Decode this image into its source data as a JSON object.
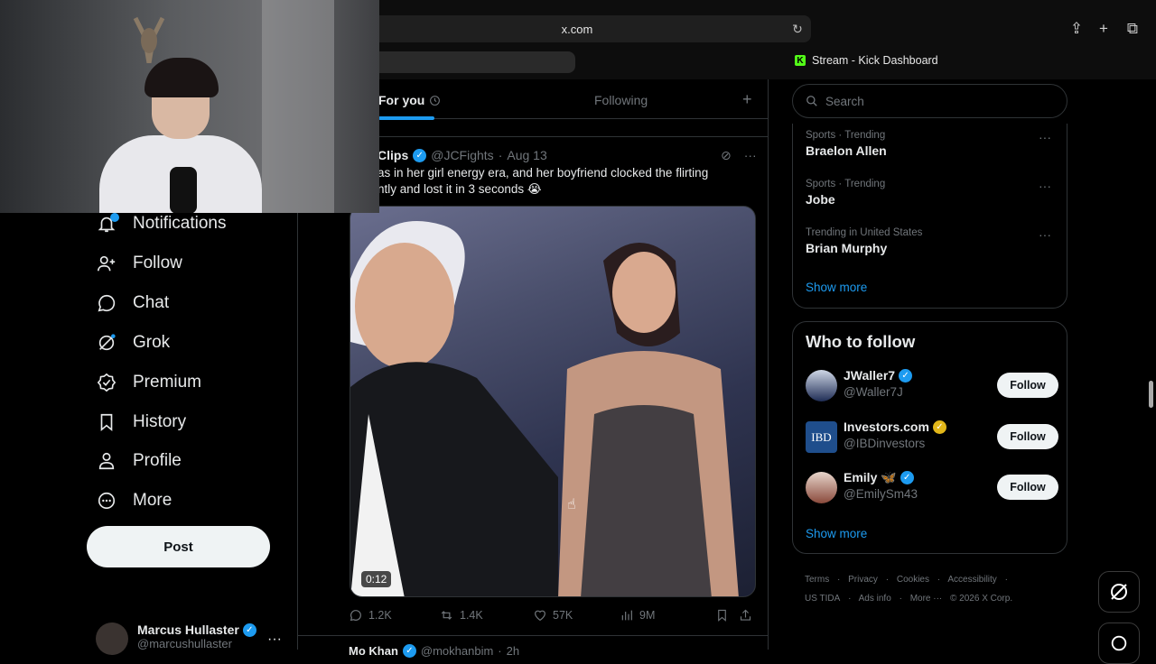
{
  "browser": {
    "url": "x.com",
    "kick_tab_label": "Stream - Kick Dashboard",
    "kick_logo": "K"
  },
  "sidebar": {
    "items": [
      {
        "label": "Notifications",
        "icon": "bell-icon"
      },
      {
        "label": "Follow",
        "icon": "add-person-icon"
      },
      {
        "label": "Chat",
        "icon": "chat-bubble-icon"
      },
      {
        "label": "Grok",
        "icon": "grok-icon"
      },
      {
        "label": "Premium",
        "icon": "verified-badge-icon"
      },
      {
        "label": "History",
        "icon": "bookmark-icon"
      },
      {
        "label": "Profile",
        "icon": "person-icon"
      },
      {
        "label": "More",
        "icon": "more-circle-icon"
      }
    ],
    "post_label": "Post",
    "account": {
      "name": "Marcus Hullaster",
      "handle": "@marcushullaster"
    }
  },
  "feed": {
    "tabs": {
      "for_you": "For you",
      "following": "Following"
    },
    "tweet": {
      "name": "Clips",
      "handle": "@JCFights",
      "date": "Aug 13",
      "text": "as in her girl energy era, and her boyfriend clocked the flirting ntly and lost it in 3 seconds 😭",
      "duration": "0:12",
      "replies": "1.2K",
      "reposts": "1.4K",
      "likes": "57K",
      "views": "9M"
    },
    "next_tweet": {
      "name": "Mo Khan",
      "handle": "@mokhanbim",
      "time": "2h"
    }
  },
  "right": {
    "search_placeholder": "Search",
    "trends": [
      {
        "meta": "Sports · Trending",
        "title": "Braelon Allen"
      },
      {
        "meta": "Sports · Trending",
        "title": "Jobe"
      },
      {
        "meta": "Trending in United States",
        "title": "Brian Murphy"
      }
    ],
    "show_more": "Show more",
    "who_to_follow": {
      "title": "Who to follow",
      "accounts": [
        {
          "name": "JWaller7",
          "handle": "@Waller7J",
          "badge": "blue"
        },
        {
          "name": "Investors.com",
          "handle": "@IBDinvestors",
          "badge": "gold",
          "avatar_text": "IBD"
        },
        {
          "name": "Emily 🦋",
          "handle": "@EmilySm43",
          "badge": "blue"
        }
      ],
      "follow_label": "Follow",
      "show_more": "Show more"
    },
    "footer": {
      "line1": [
        "Terms",
        "·",
        "Privacy",
        "·",
        "Cookies",
        "·",
        "Accessibility",
        "·"
      ],
      "line2": [
        "US TIDA",
        "·",
        "Ads info",
        "·",
        "More ···",
        "© 2026 X Corp."
      ]
    }
  },
  "colors": {
    "accent": "#1d9bf0",
    "background": "#000000",
    "text": "#e7e9ea",
    "muted": "#71767b"
  }
}
